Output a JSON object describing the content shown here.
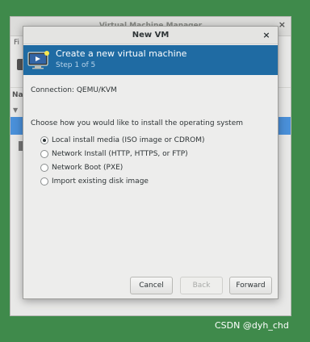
{
  "background_window": {
    "title": "Virtual Machine Manager",
    "close_glyph": "×",
    "menu_fragment": "Fi",
    "list_header_fragment": "Na"
  },
  "dialog": {
    "title": "New VM",
    "close_glyph": "×",
    "banner": {
      "title": "Create a new virtual machine",
      "step": "Step 1 of 5",
      "icon": "monitor-icon"
    },
    "connection_label": "Connection:",
    "connection_value": "QEMU/KVM",
    "prompt": "Choose how you would like to install the operating system",
    "options": [
      {
        "label": "Local install media (ISO image or CDROM)",
        "selected": true
      },
      {
        "label": "Network Install (HTTP, HTTPS, or FTP)",
        "selected": false
      },
      {
        "label": "Network Boot (PXE)",
        "selected": false
      },
      {
        "label": "Import existing disk image",
        "selected": false
      }
    ],
    "buttons": {
      "cancel": "Cancel",
      "back": "Back",
      "forward": "Forward"
    }
  },
  "watermark": "CSDN @dyh_chd",
  "colors": {
    "desktop": "#3f8a4b",
    "banner": "#1f6ba3",
    "selection": "#4a90d9"
  }
}
